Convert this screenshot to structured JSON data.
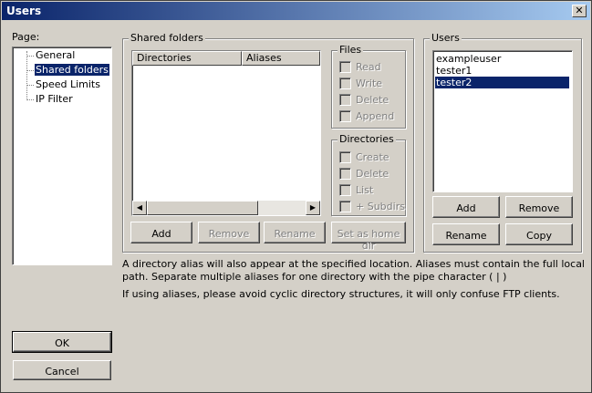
{
  "window": {
    "title": "Users",
    "close_glyph": "✕"
  },
  "page_panel": {
    "label": "Page:",
    "items": [
      {
        "label": "General",
        "selected": false
      },
      {
        "label": "Shared folders",
        "selected": true
      },
      {
        "label": "Speed Limits",
        "selected": false
      },
      {
        "label": "IP Filter",
        "selected": false
      }
    ]
  },
  "shared_folders": {
    "group_label": "Shared folders",
    "columns": [
      "Directories",
      "Aliases"
    ],
    "buttons": {
      "add": "Add",
      "remove": "Remove",
      "rename": "Rename",
      "set_home": "Set as home dir"
    },
    "files_group": {
      "label": "Files",
      "options": [
        "Read",
        "Write",
        "Delete",
        "Append"
      ]
    },
    "dirs_group": {
      "label": "Directories",
      "options": [
        "Create",
        "Delete",
        "List",
        "+ Subdirs"
      ]
    }
  },
  "users_panel": {
    "label": "Users",
    "items": [
      {
        "label": "exampleuser",
        "selected": false
      },
      {
        "label": "tester1",
        "selected": false
      },
      {
        "label": "tester2",
        "selected": true
      }
    ],
    "buttons": {
      "add": "Add",
      "remove": "Remove",
      "rename": "Rename",
      "copy": "Copy"
    }
  },
  "info": {
    "line1": "A directory alias will also appear at the specified location. Aliases must contain the full local",
    "line2": "path. Separate multiple aliases for one directory with the pipe character ( | )",
    "line3": "If using aliases, please avoid cyclic directory structures, it will only confuse FTP clients."
  },
  "footer": {
    "ok": "OK",
    "cancel": "Cancel"
  }
}
